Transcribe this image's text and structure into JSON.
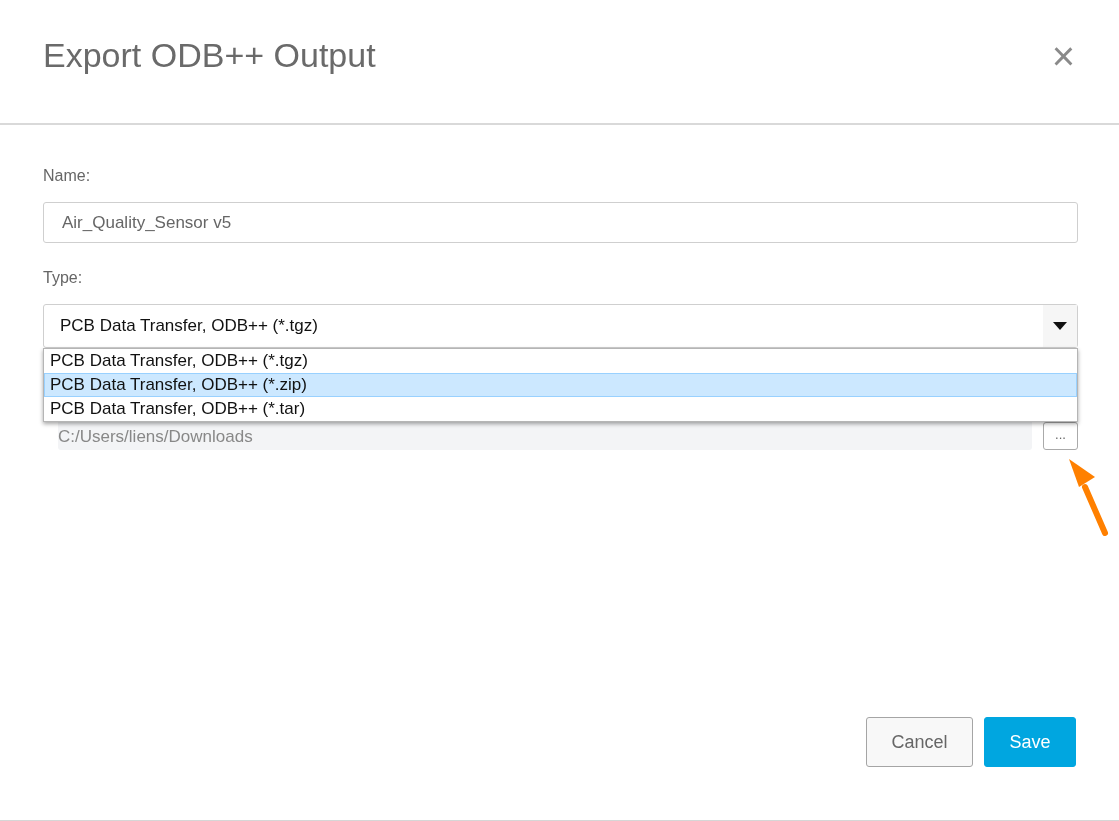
{
  "dialog": {
    "title": "Export ODB++ Output",
    "close": "×"
  },
  "name_field": {
    "label": "Name:",
    "value": "Air_Quality_Sensor v5"
  },
  "type_field": {
    "label": "Type:",
    "value": "PCB Data Transfer, ODB++ (*.tgz)",
    "expanded": true,
    "options": [
      {
        "label": "PCB Data Transfer, ODB++ (*.tgz)",
        "highlighted": false
      },
      {
        "label": "PCB Data Transfer, ODB++ (*.zip)",
        "highlighted": true
      },
      {
        "label": "PCB Data Transfer, ODB++ (*.tar)",
        "highlighted": false
      }
    ]
  },
  "path_field": {
    "value": "C:/Users/liens/Downloads",
    "browse": "..."
  },
  "buttons": [
    {
      "label": "Cancel",
      "kind": "secondary"
    },
    {
      "label": "Save",
      "kind": "primary"
    }
  ]
}
